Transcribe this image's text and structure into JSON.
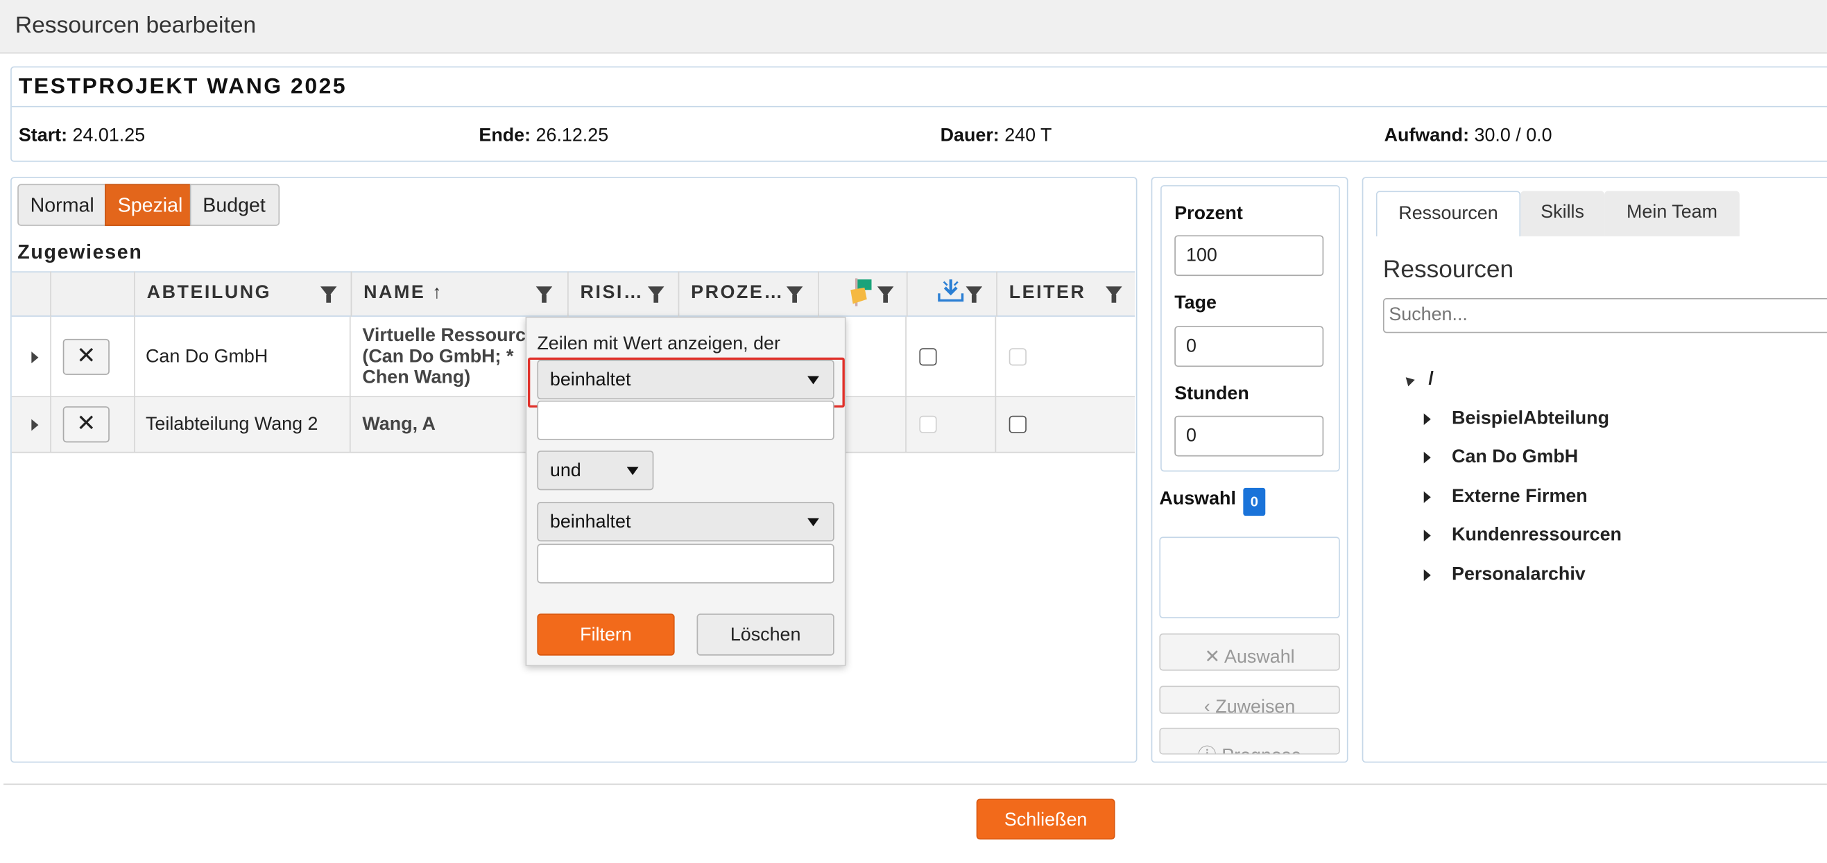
{
  "window": {
    "title": "Ressourcen bearbeiten"
  },
  "project": {
    "name": "TESTPROJEKT WANG 2025",
    "start_label": "Start:",
    "start_value": "24.01.25",
    "end_label": "Ende:",
    "end_value": "26.12.25",
    "duration_label": "Dauer:",
    "duration_value": "240 T",
    "effort_label": "Aufwand:",
    "effort_value": "30.0 / 0.0"
  },
  "view_modes": [
    "Normal",
    "Spezial",
    "Budget"
  ],
  "active_view_mode": "Spezial",
  "assigned": {
    "title": "Zugewiesen",
    "columns": [
      "ABTEILUNG",
      "NAME",
      "RISI…",
      "PROZE…",
      "LEITER"
    ],
    "name_sort": "↑",
    "rows": [
      {
        "department": "Can Do GmbH",
        "name_line1": "Virtuelle Ressourc",
        "name_line2": "(Can Do GmbH; *",
        "name_line3": "Chen Wang)",
        "remove": "✕"
      },
      {
        "department": "Teilabteilung Wang 2",
        "name_line1": "Wang, A",
        "remove": "✕"
      }
    ]
  },
  "filter_popup": {
    "prompt": "Zeilen mit Wert anzeigen, der",
    "operator1": "beinhaltet",
    "value1": "",
    "logic": "und",
    "operator2": "beinhaltet",
    "value2": "",
    "apply_label": "Filtern",
    "clear_label": "Löschen"
  },
  "allocation": {
    "percent_label": "Prozent",
    "percent_value": "100",
    "days_label": "Tage",
    "days_value": "0",
    "hours_label": "Stunden",
    "hours_value": "0",
    "selection_label": "Auswahl",
    "selection_count": "0",
    "clear_selection_label": "✕ Auswahl",
    "assign_label": "‹ Zuweisen",
    "forecast_label": "ⓘ Prognose"
  },
  "resources": {
    "tabs": [
      "Ressourcen",
      "Skills",
      "Mein Team"
    ],
    "heading": "Ressourcen",
    "search_placeholder": "Suchen...",
    "root": "/",
    "tree": [
      "BeispielAbteilung",
      "Can Do GmbH",
      "Externe Firmen",
      "Kundenressourcen",
      "Personalarchiv"
    ]
  },
  "footer": {
    "close_label": "Schließen"
  },
  "colors": {
    "accent": "#f26a1b",
    "border": "#c5d7e8",
    "badge": "#1a73d9"
  }
}
